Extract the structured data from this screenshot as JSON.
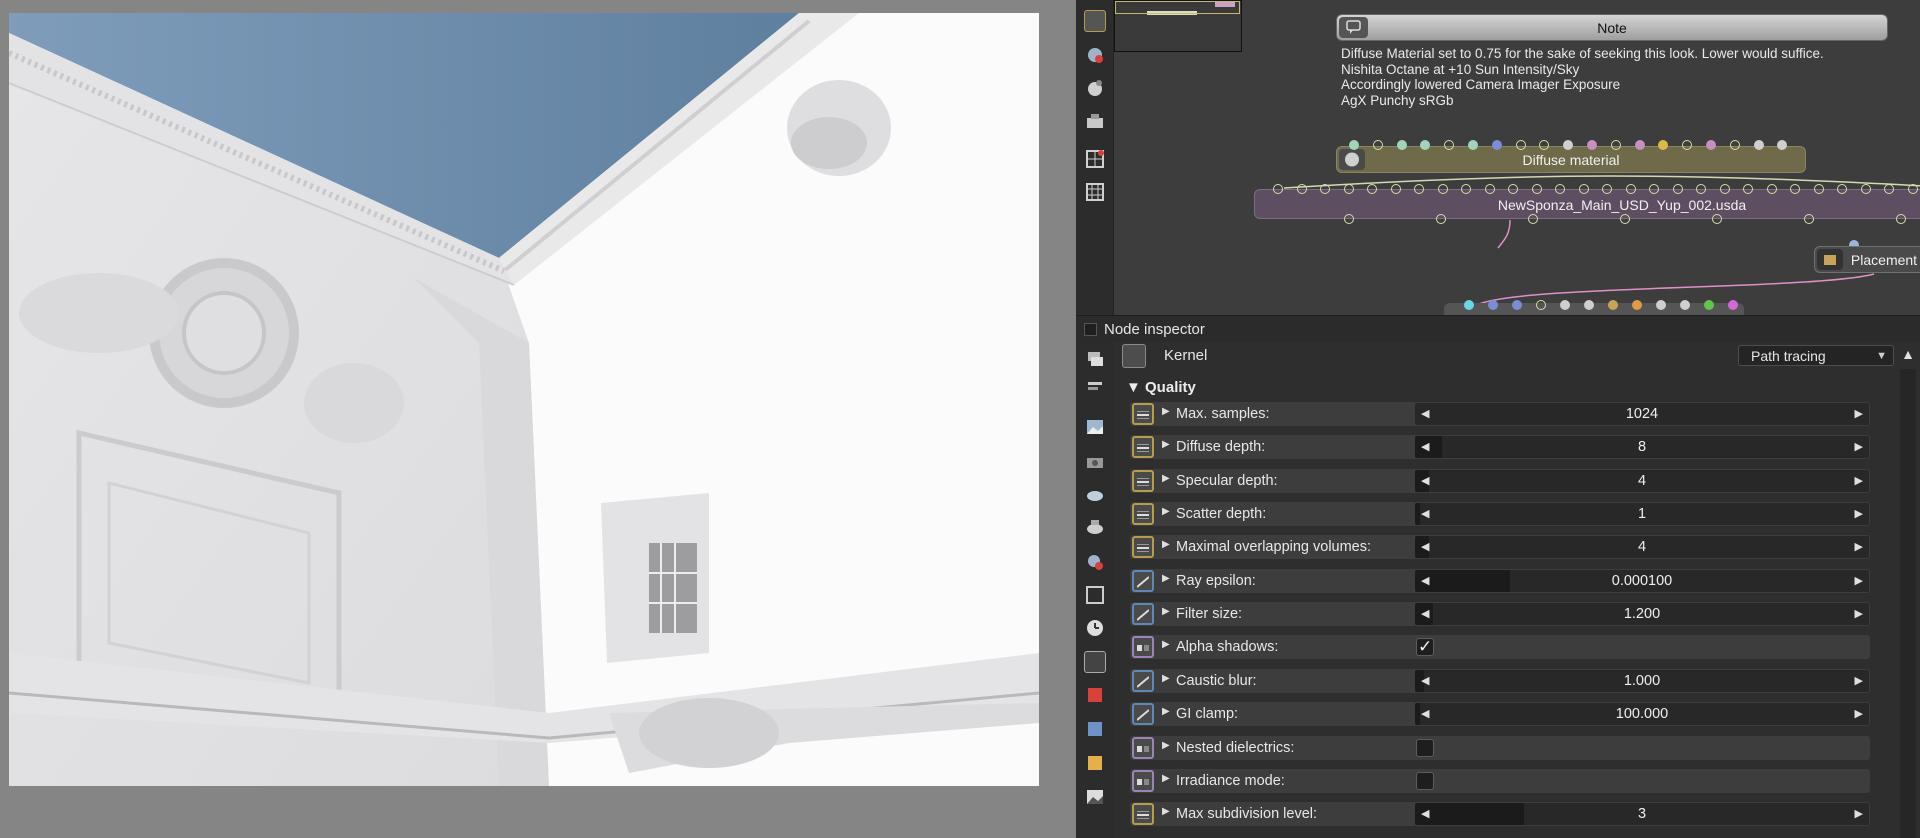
{
  "graph": {
    "note": {
      "title": "Note",
      "lines": [
        "Diffuse Material set to 0.75 for the sake of seeking this look. Lower would suffice.",
        "Nishita Octane at +10 Sun Intensity/Sky",
        "Accordingly lowered Camera Imager Exposure",
        "AgX Punchy sRGb"
      ]
    },
    "nodes": {
      "diffuse_material": "Diffuse material",
      "scene": "NewSponza_Main_USD_Yup_002.usda",
      "placement": "Placement"
    }
  },
  "inspector": {
    "title": "Node inspector",
    "kernel_label": "Kernel",
    "kernel_value": "Path tracing",
    "section": "Quality",
    "params": [
      {
        "label": "Max. samples:",
        "value": "1024",
        "type": "int",
        "fill": 0.0
      },
      {
        "label": "Diffuse depth:",
        "value": "8",
        "type": "int",
        "fill": 0.06
      },
      {
        "label": "Specular depth:",
        "value": "4",
        "type": "int",
        "fill": 0.03
      },
      {
        "label": "Scatter depth:",
        "value": "1",
        "type": "int",
        "fill": 0.01
      },
      {
        "label": "Maximal overlapping volumes:",
        "value": "4",
        "type": "int",
        "fill": 0.03
      },
      {
        "label": "Ray epsilon:",
        "value": "0.000100",
        "type": "float",
        "fill": 0.21
      },
      {
        "label": "Filter size:",
        "value": "1.200",
        "type": "float",
        "fill": 0.04
      },
      {
        "label": "Alpha shadows:",
        "value": "",
        "type": "bool",
        "checked": true
      },
      {
        "label": "Caustic blur:",
        "value": "1.000",
        "type": "float",
        "fill": 0.02
      },
      {
        "label": "GI clamp:",
        "value": "100.000",
        "type": "float",
        "fill": 0.01
      },
      {
        "label": "Nested dielectrics:",
        "value": "",
        "type": "bool",
        "checked": false
      },
      {
        "label": "Irradiance mode:",
        "value": "",
        "type": "bool",
        "checked": false
      },
      {
        "label": "Max subdivision level:",
        "value": "3",
        "type": "int",
        "fill": 0.24
      }
    ]
  },
  "colors": {
    "sky": "#6889aa",
    "int_icon": "#b79d4a",
    "float_icon": "#5e88b8",
    "bool_icon": "#9a84b8",
    "node_olive": "#6e6a4a",
    "node_purple": "#5e4e62"
  }
}
